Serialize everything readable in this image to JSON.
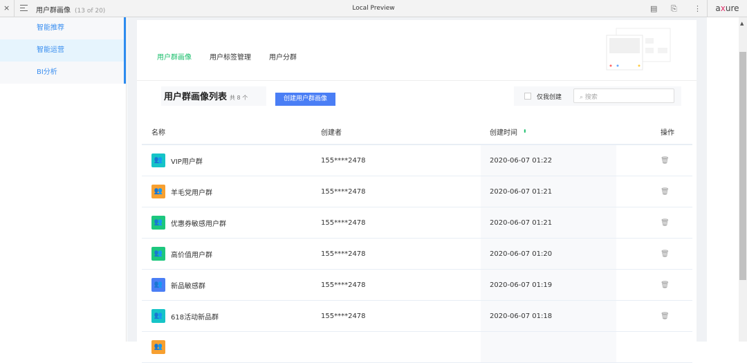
{
  "topbar": {
    "close": "×",
    "title": "用户群画像",
    "page_count": "(13 of 20)",
    "center_title": "Local Preview",
    "brand_pre": "a",
    "brand_x": "x",
    "brand_post": "ure"
  },
  "sidebar": {
    "items": [
      {
        "label": "智能推荐"
      },
      {
        "label": "智能运营"
      },
      {
        "label": "BI分析"
      }
    ]
  },
  "tabs": [
    {
      "label": "用户群画像"
    },
    {
      "label": "用户标签管理"
    },
    {
      "label": "用户分群"
    }
  ],
  "list": {
    "title": "用户群画像列表",
    "count": "共 8 个",
    "create_button": "创建用户群画像",
    "only_mine": "仅我创建",
    "search_placeholder": "搜索"
  },
  "table": {
    "headers": [
      "名称",
      "创建者",
      "创建时间",
      "操作"
    ],
    "rows": [
      {
        "name": "VIP用户群",
        "creator": "155****2478",
        "time": "2020-06-07 01:22",
        "color": "#16c4c7"
      },
      {
        "name": "羊毛党用户群",
        "creator": "155****2478",
        "time": "2020-06-07 01:21",
        "color": "#f7a030"
      },
      {
        "name": "优惠券敏感用户群",
        "creator": "155****2478",
        "time": "2020-06-07 01:21",
        "color": "#1dc77e"
      },
      {
        "name": "高价值用户群",
        "creator": "155****2478",
        "time": "2020-06-07 01:20",
        "color": "#1dc77e"
      },
      {
        "name": "新品敏感群",
        "creator": "155****2478",
        "time": "2020-06-07 01:19",
        "color": "#4a7ef5"
      },
      {
        "name": "618活动新品群",
        "creator": "155****2478",
        "time": "2020-06-07 01:18",
        "color": "#16c4c7"
      },
      {
        "name": "",
        "creator": "",
        "time": "",
        "color": "#f7a030"
      }
    ]
  },
  "colors": {
    "accent": "#19be6b",
    "primary": "#4a7ef5",
    "nav": "#2d8cf0"
  }
}
